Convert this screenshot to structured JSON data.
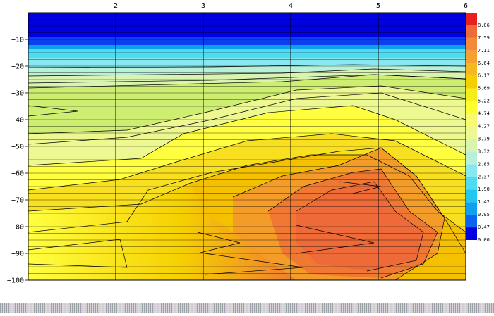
{
  "chart_data": {
    "type": "heatmap",
    "title": "",
    "xlabel": "",
    "ylabel": "",
    "x_ticks": [
      2,
      3,
      4,
      5,
      6
    ],
    "y_ticks": [
      -10,
      -20,
      -30,
      -40,
      -50,
      -60,
      -70,
      -80,
      -90,
      -100
    ],
    "xlim": [
      1,
      6
    ],
    "ylim": [
      -100,
      0
    ],
    "colorbar": {
      "levels": [
        "0.00",
        "0.47",
        "0.95",
        "1.42",
        "1.90",
        "2.37",
        "2.85",
        "3.32",
        "3.79",
        "4.27",
        "4.74",
        "5.22",
        "5.69",
        "6.17",
        "6.64",
        "7.11",
        "7.59",
        "8.06"
      ],
      "colors": [
        "#0000e0",
        "#0a64f0",
        "#10a0f0",
        "#20c8f0",
        "#50dcf0",
        "#88e8f0",
        "#b8f0d8",
        "#d8f4b0",
        "#eef890",
        "#f8fa70",
        "#ffff30",
        "#f6ee18",
        "#f4d000",
        "#f4b820",
        "#f6a030",
        "#f48a38",
        "#ee6a38",
        "#e82020"
      ]
    },
    "grid": "on"
  }
}
